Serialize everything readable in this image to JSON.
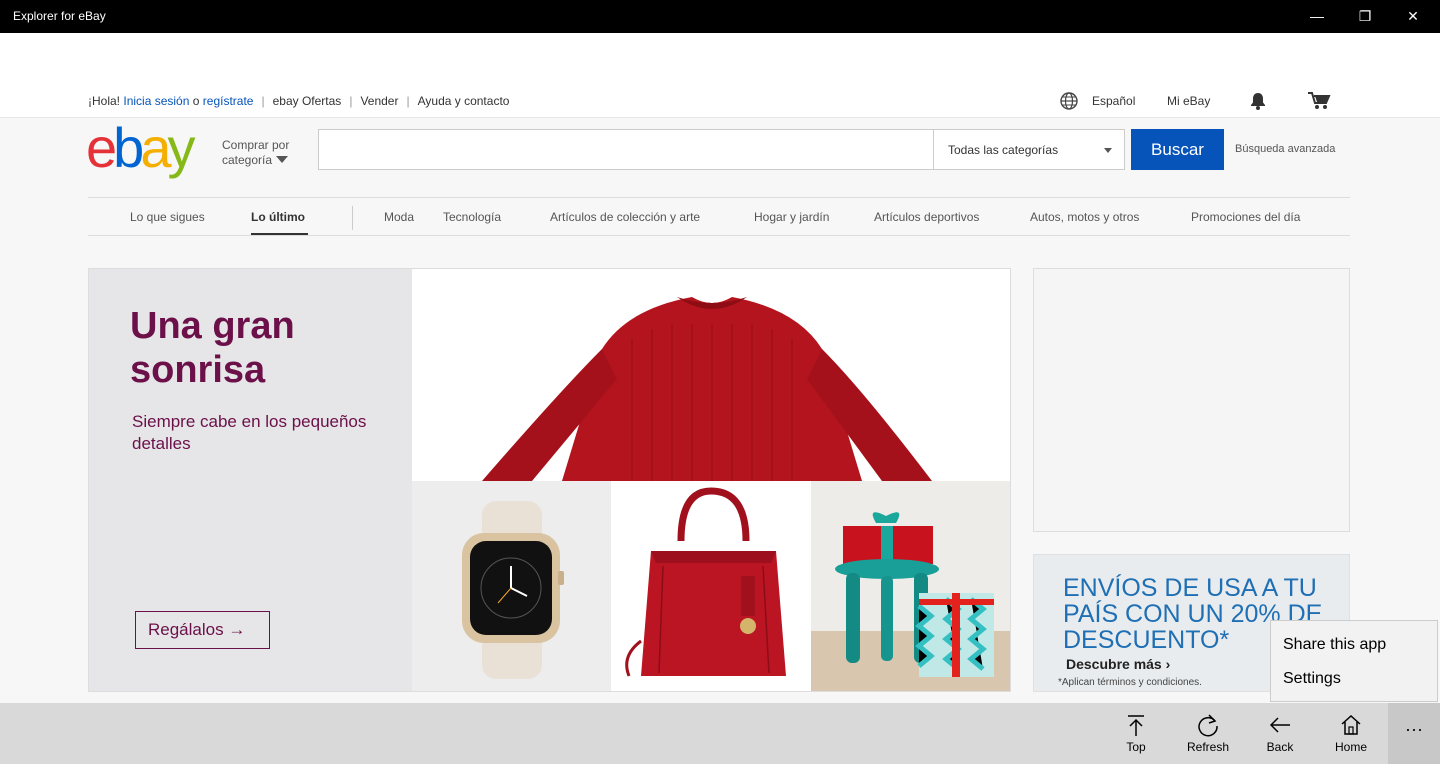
{
  "window": {
    "title": "Explorer for eBay",
    "minimize": "—",
    "maximize": "❐",
    "close": "✕"
  },
  "topbar": {
    "greeting_prefix": "¡Hola!",
    "signin": "Inicia sesión",
    "or": "o",
    "register": "regístrate",
    "links": [
      "ebay Ofertas",
      "Vender",
      "Ayuda y contacto"
    ],
    "language": "Español",
    "my_ebay": "Mi eBay"
  },
  "header": {
    "logo": {
      "e": "e",
      "b": "b",
      "a": "a",
      "y": "y"
    },
    "shop_by_line1": "Comprar por",
    "shop_by_line2": "categoría",
    "search_value": "",
    "category_selected": "Todas las categorías",
    "search_button": "Buscar",
    "advanced": "Búsqueda avanzada"
  },
  "nav": {
    "items": [
      "Lo que sigues",
      "Lo último",
      "Moda",
      "Tecnología",
      "Artículos de colección y arte",
      "Hogar y jardín",
      "Artículos deportivos",
      "Autos, motos y otros",
      "Promociones del día"
    ],
    "active_index": 1
  },
  "banner": {
    "headline": "Una gran sonrisa",
    "subtitle": "Siempre cabe en los pequeños detalles",
    "cta": "Regálalos →"
  },
  "promo": {
    "headline": "ENVÍOS DE USA A TU PAÍS CON UN 20% DE DESCUENTO*",
    "more": "Descubre más ›",
    "terms": "*Aplican términos y condiciones."
  },
  "flyout": {
    "share": "Share this app",
    "settings": "Settings"
  },
  "appbar": {
    "top": "Top",
    "refresh": "Refresh",
    "back": "Back",
    "home": "Home",
    "more": "···"
  },
  "colors": {
    "ebay_blue": "#0654ba",
    "banner_purple": "#6b1049",
    "title_bar": "#000000"
  }
}
